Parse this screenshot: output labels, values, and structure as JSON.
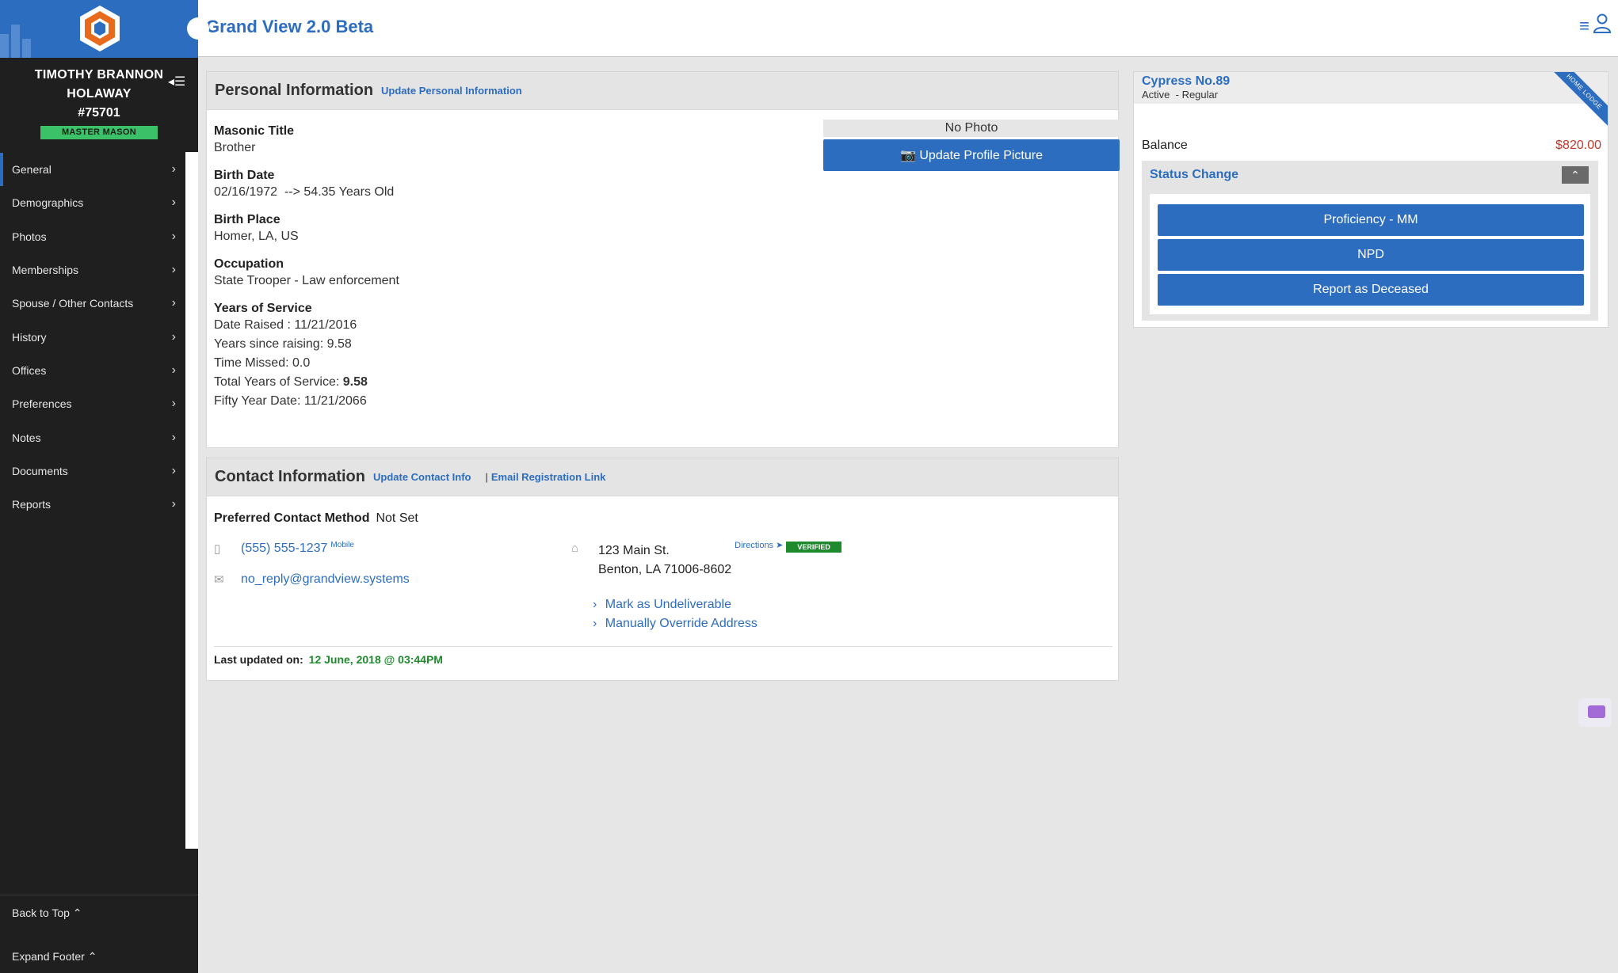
{
  "app": {
    "title": "Grand View 2.0 Beta"
  },
  "member": {
    "name": "TIMOTHY BRANNON HOLAWAY",
    "number": "#75701",
    "rank": "MASTER MASON"
  },
  "sidebar": {
    "items": [
      {
        "label": "General",
        "active": true
      },
      {
        "label": "Demographics"
      },
      {
        "label": "Photos"
      },
      {
        "label": "Memberships"
      },
      {
        "label": "Spouse / Other Contacts"
      },
      {
        "label": "History"
      },
      {
        "label": "Offices"
      },
      {
        "label": "Preferences"
      },
      {
        "label": "Notes"
      },
      {
        "label": "Documents"
      },
      {
        "label": "Reports"
      }
    ],
    "back_to_top": "Back to Top ⌃",
    "expand_footer": "Expand Footer ⌃"
  },
  "personal": {
    "title": "Personal Information",
    "update_link": "Update Personal Information",
    "masonic_title_label": "Masonic Title",
    "masonic_title": "Brother",
    "birth_date_label": "Birth Date",
    "birth_date": "02/16/1972  --> 54.35 Years Old",
    "birth_place_label": "Birth Place",
    "birth_place": "Homer, LA, US",
    "occupation_label": "Occupation",
    "occupation": "State Trooper - Law enforcement",
    "service_label": "Years of Service",
    "date_raised": "Date Raised : 11/21/2016",
    "years_since_raising": "Years since raising: 9.58",
    "time_missed": "Time Missed: 0.0",
    "total_years_label": "Total Years of Service:",
    "total_years": "9.58",
    "fifty_year": "Fifty Year Date: 11/21/2066",
    "no_photo": "No Photo",
    "update_photo": "Update Profile Picture"
  },
  "contact": {
    "title": "Contact Information",
    "update_link": "Update Contact Info",
    "separator": "|",
    "email_reg_link": "Email Registration Link",
    "pref_label": "Preferred Contact Method",
    "pref_value": "Not Set",
    "phone": "(555) 555-1237",
    "phone_type": "Mobile",
    "email": "no_reply@grandview.systems",
    "address_line1": "123 Main St.",
    "address_line2": "Benton, LA 71006-8602",
    "directions": "Directions",
    "verified": "VERIFIED",
    "mark_undeliverable": "Mark as Undeliverable",
    "override_address": "Manually Override Address",
    "last_updated_label": "Last updated on:",
    "last_updated": "12 June, 2018 @ 03:44PM"
  },
  "lodge": {
    "name": "Cypress No.89",
    "status": "Active  - Regular",
    "ribbon": "HOME LODGE",
    "balance_label": "Balance",
    "balance": "$820.00",
    "status_change_title": "Status Change",
    "buttons": [
      "Proficiency - MM",
      "NPD",
      "Report as Deceased"
    ]
  },
  "colors": {
    "accent": "#2d6dc0",
    "sidebar_bg": "#1f1f1f",
    "badge_green": "#3bc167",
    "balance_red": "#c0392b",
    "verified_green": "#1e8a2d",
    "date_green": "#1e8a2d"
  }
}
